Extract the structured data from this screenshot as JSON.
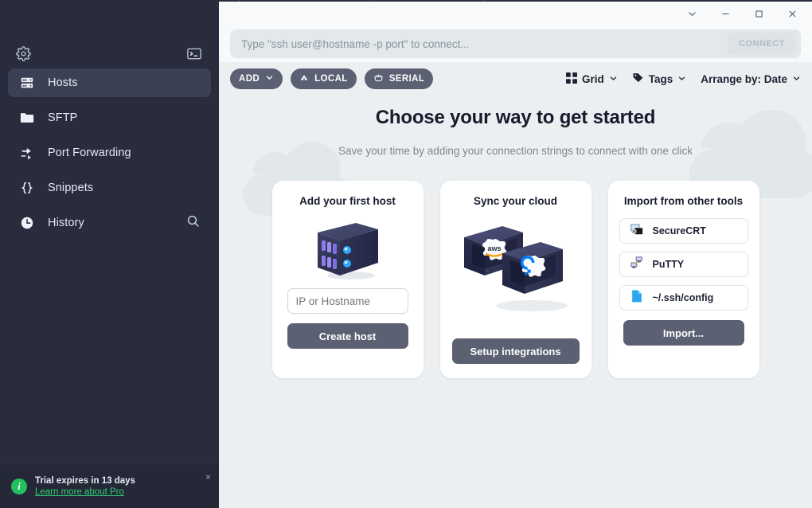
{
  "sidebar": {
    "settings_icon": "gear-icon",
    "terminal_icon": "terminal-icon",
    "search_icon": "search-icon",
    "items": [
      {
        "label": "Hosts",
        "icon": "server-rack-icon",
        "active": true
      },
      {
        "label": "SFTP",
        "icon": "folder-icon",
        "active": false
      },
      {
        "label": "Port Forwarding",
        "icon": "port-forwarding-icon",
        "active": false
      },
      {
        "label": "Snippets",
        "icon": "braces-icon",
        "active": false
      },
      {
        "label": "History",
        "icon": "clock-icon",
        "active": false
      }
    ],
    "trial": {
      "title": "Trial expires in 13 days",
      "link": "Learn more about Pro",
      "close": "×",
      "info_icon": "info-icon",
      "accent": "#23c05f"
    }
  },
  "titlebar": {
    "buttons": [
      {
        "name": "chevron-down-icon",
        "glyph": "⌄"
      },
      {
        "name": "minimize-icon",
        "glyph": "–"
      },
      {
        "name": "maximize-icon",
        "glyph": "□"
      },
      {
        "name": "close-icon",
        "glyph": "✕"
      }
    ]
  },
  "connect_bar": {
    "placeholder": "Type \"ssh user@hostname -p port\" to connect...",
    "value": "",
    "connect_label": "CONNECT"
  },
  "toolbar": {
    "add_label": "ADD",
    "local_label": "LOCAL",
    "serial_label": "SERIAL",
    "grid_label": "Grid",
    "tags_label": "Tags",
    "arrange_label": "Arrange by: Date"
  },
  "hero": {
    "title": "Choose your way to get started",
    "subtitle": "Save your time by adding your connection strings to connect with one click"
  },
  "cards": {
    "host": {
      "title": "Add your first host",
      "art": "server-3d-illustration",
      "input_placeholder": "IP or Hostname",
      "input_value": "",
      "cta": "Create host"
    },
    "cloud": {
      "title": "Sync your cloud",
      "art": "cloud-providers-3d-illustration",
      "providers": [
        "aws",
        "digitalocean"
      ],
      "cta": "Setup integrations"
    },
    "import": {
      "title": "Import from other tools",
      "items": [
        {
          "label": "SecureCRT",
          "icon": "securecrt-icon"
        },
        {
          "label": "PuTTY",
          "icon": "putty-icon"
        },
        {
          "label": "~/.ssh/config",
          "icon": "file-icon"
        }
      ],
      "cta": "Import..."
    }
  },
  "colors": {
    "sidebar_bg": "#282c3d",
    "sidebar_active": "#3b4054",
    "content_bg": "#eceff1",
    "button_slate": "#5b6072",
    "accent_green": "#23c05f",
    "card_bg": "#ffffff"
  }
}
